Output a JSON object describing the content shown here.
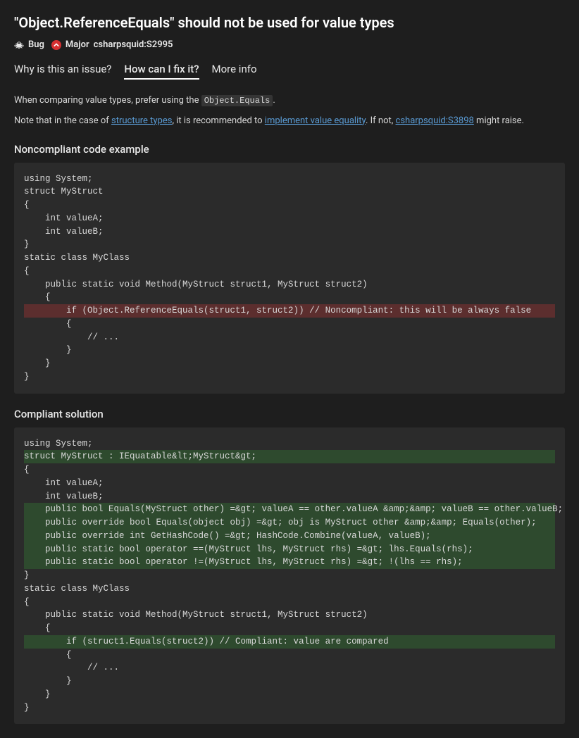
{
  "title": "\"Object.ReferenceEquals\" should not be used for value types",
  "meta": {
    "bug_label": "Bug",
    "severity_label": "Major",
    "rule_id": "csharpsquid:S2995"
  },
  "tabs": {
    "why": "Why is this an issue?",
    "how": "How can I fix it?",
    "more": "More info"
  },
  "intro": {
    "prefix": "When comparing value types, prefer using the ",
    "code": "Object.Equals",
    "suffix": "."
  },
  "note": {
    "p1": "Note that in the case of ",
    "link1": "structure types",
    "p2": ", it is recommended to ",
    "link2": "implement value equality",
    "p3": ". If not, ",
    "link3": "csharpsquid:S3898",
    "p4": " might raise."
  },
  "noncompliant_header": "Noncompliant code example",
  "noncompliant_code": {
    "l1": "using System;",
    "l2": "struct MyStruct",
    "l3": "{",
    "l4": "    int valueA;",
    "l5": "    int valueB;",
    "l6": "}",
    "l7": "static class MyClass",
    "l8": "{",
    "l9": "    public static void Method(MyStruct struct1, MyStruct struct2)",
    "l10": "    {",
    "l11": "        if (Object.ReferenceEquals(struct1, struct2)) // Noncompliant: this will be always false",
    "l12": "        {",
    "l13": "            // ...",
    "l14": "        }",
    "l15": "    }",
    "l16": "}"
  },
  "compliant_header": "Compliant solution",
  "compliant_code": {
    "l1": "using System;",
    "l2": "struct MyStruct : IEquatable&lt;MyStruct&gt;",
    "l3": "{",
    "l4": "    int valueA;",
    "l5": "    int valueB;",
    "l6": "    public bool Equals(MyStruct other) =&gt; valueA == other.valueA &amp;&amp; valueB == other.valueB;",
    "l7": "    public override bool Equals(object obj) =&gt; obj is MyStruct other &amp;&amp; Equals(other);",
    "l8": "    public override int GetHashCode() =&gt; HashCode.Combine(valueA, valueB);",
    "l9": "    public static bool operator ==(MyStruct lhs, MyStruct rhs) =&gt; lhs.Equals(rhs);",
    "l10": "    public static bool operator !=(MyStruct lhs, MyStruct rhs) =&gt; !(lhs == rhs);",
    "l11": "}",
    "l12": "static class MyClass",
    "l13": "{",
    "l14": "    public static void Method(MyStruct struct1, MyStruct struct2)",
    "l15": "    {",
    "l16": "        if (struct1.Equals(struct2)) // Compliant: value are compared",
    "l17": "        {",
    "l18": "            // ...",
    "l19": "        }",
    "l20": "    }",
    "l21": "}"
  }
}
